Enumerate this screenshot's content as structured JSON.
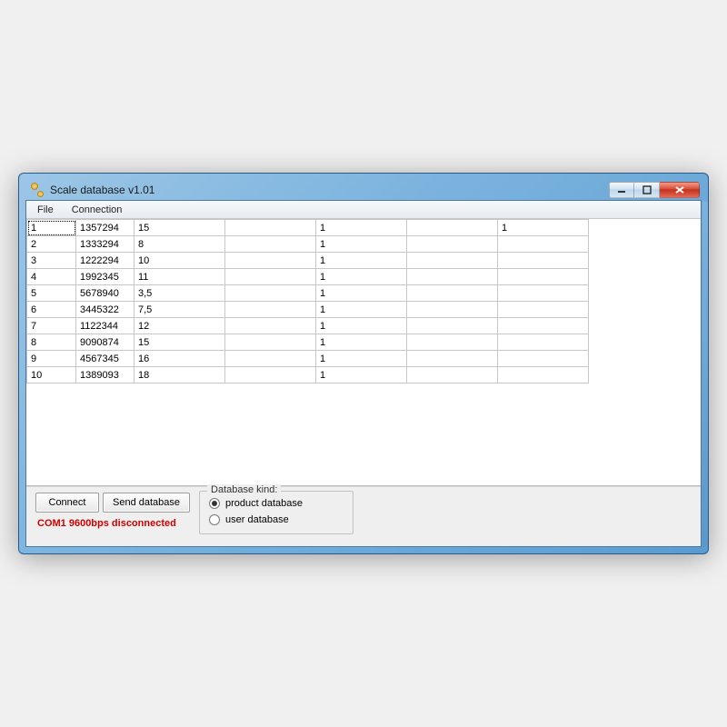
{
  "window": {
    "title": "Scale database v1.01"
  },
  "menubar": {
    "items": [
      "File",
      "Connection"
    ]
  },
  "grid": {
    "columns": 7,
    "rows": [
      [
        "1",
        "1357294",
        "15",
        "",
        "1",
        "",
        "1"
      ],
      [
        "2",
        "1333294",
        "8",
        "",
        "1",
        "",
        ""
      ],
      [
        "3",
        "1222294",
        "10",
        "",
        "1",
        "",
        ""
      ],
      [
        "4",
        "1992345",
        "11",
        "",
        "1",
        "",
        ""
      ],
      [
        "5",
        "5678940",
        "3,5",
        "",
        "1",
        "",
        ""
      ],
      [
        "6",
        "3445322",
        "7,5",
        "",
        "1",
        "",
        ""
      ],
      [
        "7",
        "1122344",
        "12",
        "",
        "1",
        "",
        ""
      ],
      [
        "8",
        "9090874",
        "15",
        "",
        "1",
        "",
        ""
      ],
      [
        "9",
        "4567345",
        "16",
        "",
        "1",
        "",
        ""
      ],
      [
        "10",
        "1389093",
        "18",
        "",
        "1",
        "",
        ""
      ]
    ]
  },
  "buttons": {
    "connect": "Connect",
    "send_db": "Send database"
  },
  "status": "COM1 9600bps disconnected",
  "groupbox": {
    "legend": "Database kind:",
    "options": {
      "product": {
        "label": "product database",
        "checked": true
      },
      "user": {
        "label": "user database",
        "checked": false
      }
    }
  }
}
